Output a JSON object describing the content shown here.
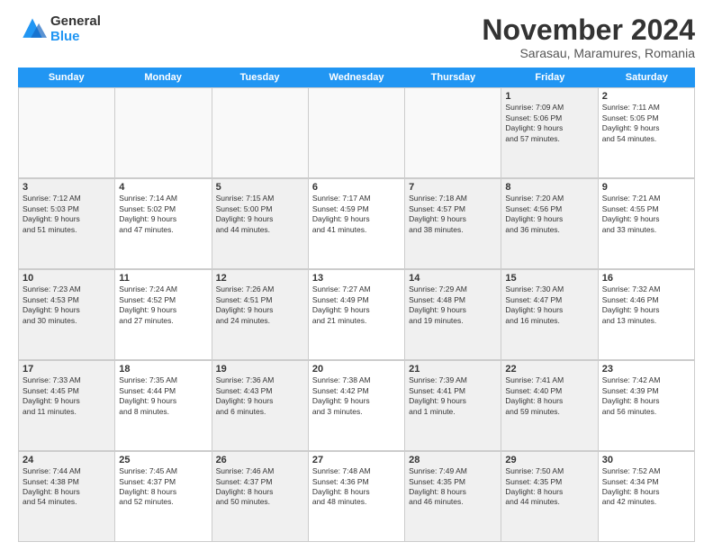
{
  "logo": {
    "general": "General",
    "blue": "Blue"
  },
  "title": "November 2024",
  "subtitle": "Sarasau, Maramures, Romania",
  "header_days": [
    "Sunday",
    "Monday",
    "Tuesday",
    "Wednesday",
    "Thursday",
    "Friday",
    "Saturday"
  ],
  "weeks": [
    [
      {
        "day": "",
        "info": "",
        "empty": true
      },
      {
        "day": "",
        "info": "",
        "empty": true
      },
      {
        "day": "",
        "info": "",
        "empty": true
      },
      {
        "day": "",
        "info": "",
        "empty": true
      },
      {
        "day": "",
        "info": "",
        "empty": true
      },
      {
        "day": "1",
        "info": "Sunrise: 7:09 AM\nSunset: 5:06 PM\nDaylight: 9 hours\nand 57 minutes.",
        "shaded": true
      },
      {
        "day": "2",
        "info": "Sunrise: 7:11 AM\nSunset: 5:05 PM\nDaylight: 9 hours\nand 54 minutes."
      }
    ],
    [
      {
        "day": "3",
        "info": "Sunrise: 7:12 AM\nSunset: 5:03 PM\nDaylight: 9 hours\nand 51 minutes.",
        "shaded": true
      },
      {
        "day": "4",
        "info": "Sunrise: 7:14 AM\nSunset: 5:02 PM\nDaylight: 9 hours\nand 47 minutes."
      },
      {
        "day": "5",
        "info": "Sunrise: 7:15 AM\nSunset: 5:00 PM\nDaylight: 9 hours\nand 44 minutes.",
        "shaded": true
      },
      {
        "day": "6",
        "info": "Sunrise: 7:17 AM\nSunset: 4:59 PM\nDaylight: 9 hours\nand 41 minutes."
      },
      {
        "day": "7",
        "info": "Sunrise: 7:18 AM\nSunset: 4:57 PM\nDaylight: 9 hours\nand 38 minutes.",
        "shaded": true
      },
      {
        "day": "8",
        "info": "Sunrise: 7:20 AM\nSunset: 4:56 PM\nDaylight: 9 hours\nand 36 minutes.",
        "shaded": true
      },
      {
        "day": "9",
        "info": "Sunrise: 7:21 AM\nSunset: 4:55 PM\nDaylight: 9 hours\nand 33 minutes."
      }
    ],
    [
      {
        "day": "10",
        "info": "Sunrise: 7:23 AM\nSunset: 4:53 PM\nDaylight: 9 hours\nand 30 minutes.",
        "shaded": true
      },
      {
        "day": "11",
        "info": "Sunrise: 7:24 AM\nSunset: 4:52 PM\nDaylight: 9 hours\nand 27 minutes."
      },
      {
        "day": "12",
        "info": "Sunrise: 7:26 AM\nSunset: 4:51 PM\nDaylight: 9 hours\nand 24 minutes.",
        "shaded": true
      },
      {
        "day": "13",
        "info": "Sunrise: 7:27 AM\nSunset: 4:49 PM\nDaylight: 9 hours\nand 21 minutes."
      },
      {
        "day": "14",
        "info": "Sunrise: 7:29 AM\nSunset: 4:48 PM\nDaylight: 9 hours\nand 19 minutes.",
        "shaded": true
      },
      {
        "day": "15",
        "info": "Sunrise: 7:30 AM\nSunset: 4:47 PM\nDaylight: 9 hours\nand 16 minutes.",
        "shaded": true
      },
      {
        "day": "16",
        "info": "Sunrise: 7:32 AM\nSunset: 4:46 PM\nDaylight: 9 hours\nand 13 minutes."
      }
    ],
    [
      {
        "day": "17",
        "info": "Sunrise: 7:33 AM\nSunset: 4:45 PM\nDaylight: 9 hours\nand 11 minutes.",
        "shaded": true
      },
      {
        "day": "18",
        "info": "Sunrise: 7:35 AM\nSunset: 4:44 PM\nDaylight: 9 hours\nand 8 minutes."
      },
      {
        "day": "19",
        "info": "Sunrise: 7:36 AM\nSunset: 4:43 PM\nDaylight: 9 hours\nand 6 minutes.",
        "shaded": true
      },
      {
        "day": "20",
        "info": "Sunrise: 7:38 AM\nSunset: 4:42 PM\nDaylight: 9 hours\nand 3 minutes."
      },
      {
        "day": "21",
        "info": "Sunrise: 7:39 AM\nSunset: 4:41 PM\nDaylight: 9 hours\nand 1 minute.",
        "shaded": true
      },
      {
        "day": "22",
        "info": "Sunrise: 7:41 AM\nSunset: 4:40 PM\nDaylight: 8 hours\nand 59 minutes.",
        "shaded": true
      },
      {
        "day": "23",
        "info": "Sunrise: 7:42 AM\nSunset: 4:39 PM\nDaylight: 8 hours\nand 56 minutes."
      }
    ],
    [
      {
        "day": "24",
        "info": "Sunrise: 7:44 AM\nSunset: 4:38 PM\nDaylight: 8 hours\nand 54 minutes.",
        "shaded": true
      },
      {
        "day": "25",
        "info": "Sunrise: 7:45 AM\nSunset: 4:37 PM\nDaylight: 8 hours\nand 52 minutes."
      },
      {
        "day": "26",
        "info": "Sunrise: 7:46 AM\nSunset: 4:37 PM\nDaylight: 8 hours\nand 50 minutes.",
        "shaded": true
      },
      {
        "day": "27",
        "info": "Sunrise: 7:48 AM\nSunset: 4:36 PM\nDaylight: 8 hours\nand 48 minutes."
      },
      {
        "day": "28",
        "info": "Sunrise: 7:49 AM\nSunset: 4:35 PM\nDaylight: 8 hours\nand 46 minutes.",
        "shaded": true
      },
      {
        "day": "29",
        "info": "Sunrise: 7:50 AM\nSunset: 4:35 PM\nDaylight: 8 hours\nand 44 minutes.",
        "shaded": true
      },
      {
        "day": "30",
        "info": "Sunrise: 7:52 AM\nSunset: 4:34 PM\nDaylight: 8 hours\nand 42 minutes."
      }
    ]
  ]
}
